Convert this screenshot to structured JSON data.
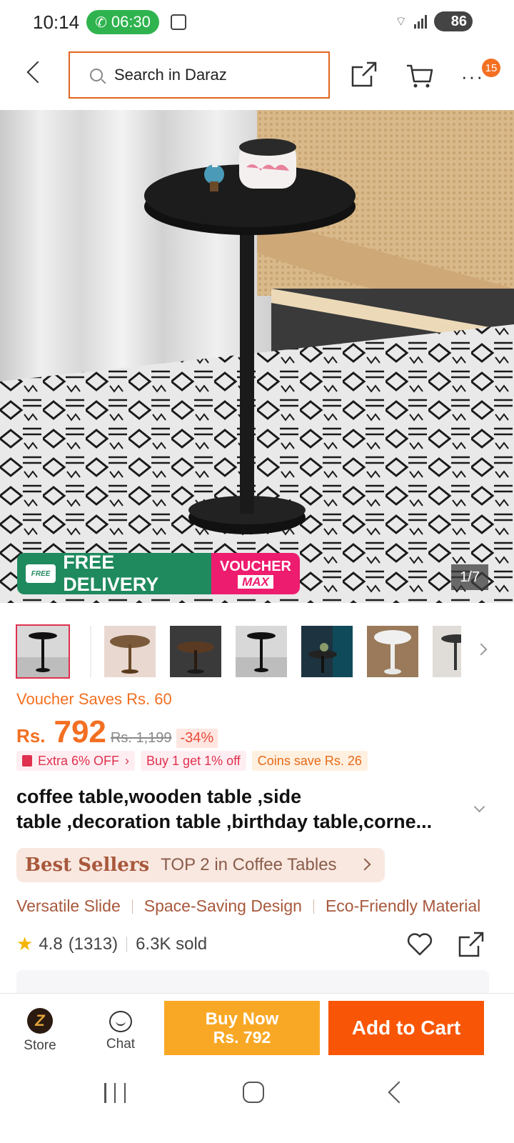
{
  "status_bar": {
    "time": "10:14",
    "call_timer": "06:30",
    "battery": "86"
  },
  "header": {
    "search_placeholder": "Search in Daraz",
    "cart_badge": "15"
  },
  "gallery": {
    "counter": "1/7",
    "promo_free_delivery": "FREE DELIVERY",
    "promo_free_badge": "FREE",
    "promo_voucher_line1": "VOUCHER",
    "promo_voucher_line2": "MAX",
    "thumbnail_count": 7,
    "selected_index": 0
  },
  "pricing": {
    "voucher_saves": "Voucher Saves Rs. 60",
    "currency": "Rs.",
    "price": "792",
    "original_price": "Rs. 1,199",
    "discount": "-34%",
    "tags": [
      "Extra 6% OFF",
      "Buy 1 get 1% off",
      "Coins save Rs. 26"
    ]
  },
  "product": {
    "title_line1": "coffee table,wooden table ,side",
    "title_line2": "table ,decoration table ,birthday table,corne...",
    "best_sellers_label": "Best Sellers",
    "best_sellers_text": "TOP 2 in Coffee Tables",
    "features": [
      "Versatile Slide",
      "Space-Saving Design",
      "Eco-Friendly Material"
    ],
    "rating": "4.8",
    "rating_count": "(1313)",
    "sold": "6.3K sold"
  },
  "actions": {
    "store_label": "Store",
    "chat_label": "Chat",
    "buy_now_line1": "Buy Now",
    "buy_now_line2": "Rs. 792",
    "add_to_cart": "Add to Cart"
  },
  "colors": {
    "accent_orange": "#f85606",
    "buy_now_yellow": "#f9a825",
    "price_orange": "#f36f21"
  }
}
